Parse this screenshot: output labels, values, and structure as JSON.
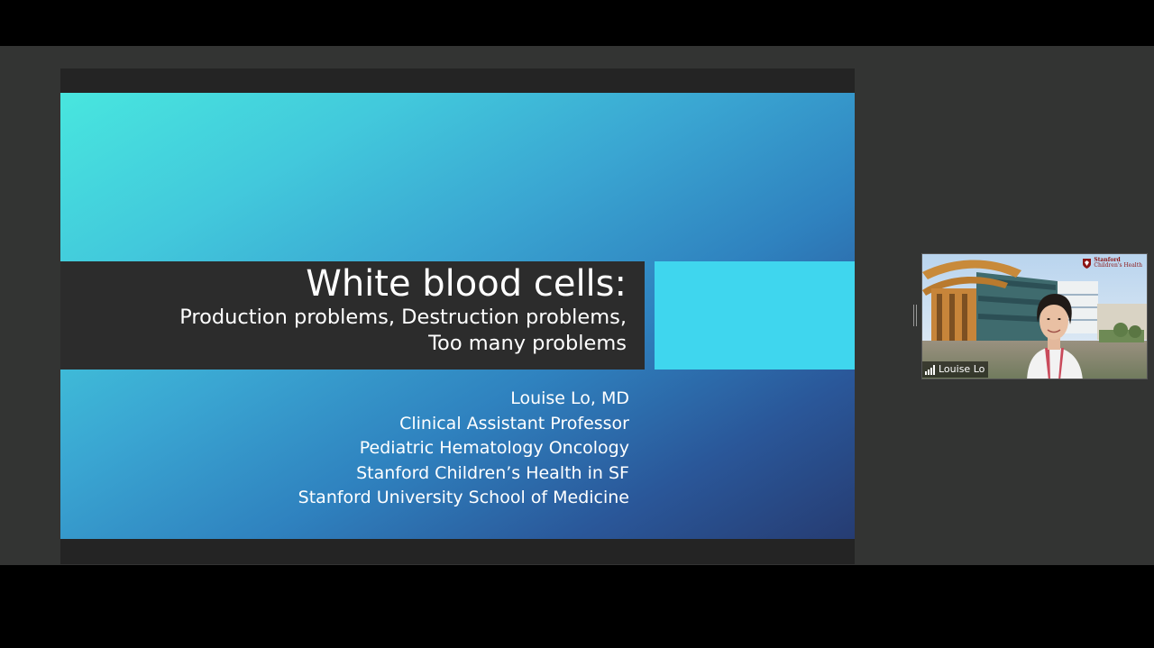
{
  "slide": {
    "title": "White blood cells:",
    "subtitle_line1": "Production problems, Destruction problems,",
    "subtitle_line2": "Too many problems",
    "author_lines": [
      "Louise Lo, MD",
      "Clinical Assistant Professor",
      "Pediatric Hematology Oncology",
      "Stanford Children’s Health in SF",
      "Stanford University School of Medicine"
    ]
  },
  "participant": {
    "name": "Louise Lo",
    "background_logo_line1": "Stanford",
    "background_logo_line2": "Children's Health"
  },
  "colors": {
    "meeting_background": "#333433",
    "title_band": "#2c2c2c",
    "accent_block": "#3fd6ee",
    "logo_red": "#8c1515"
  }
}
